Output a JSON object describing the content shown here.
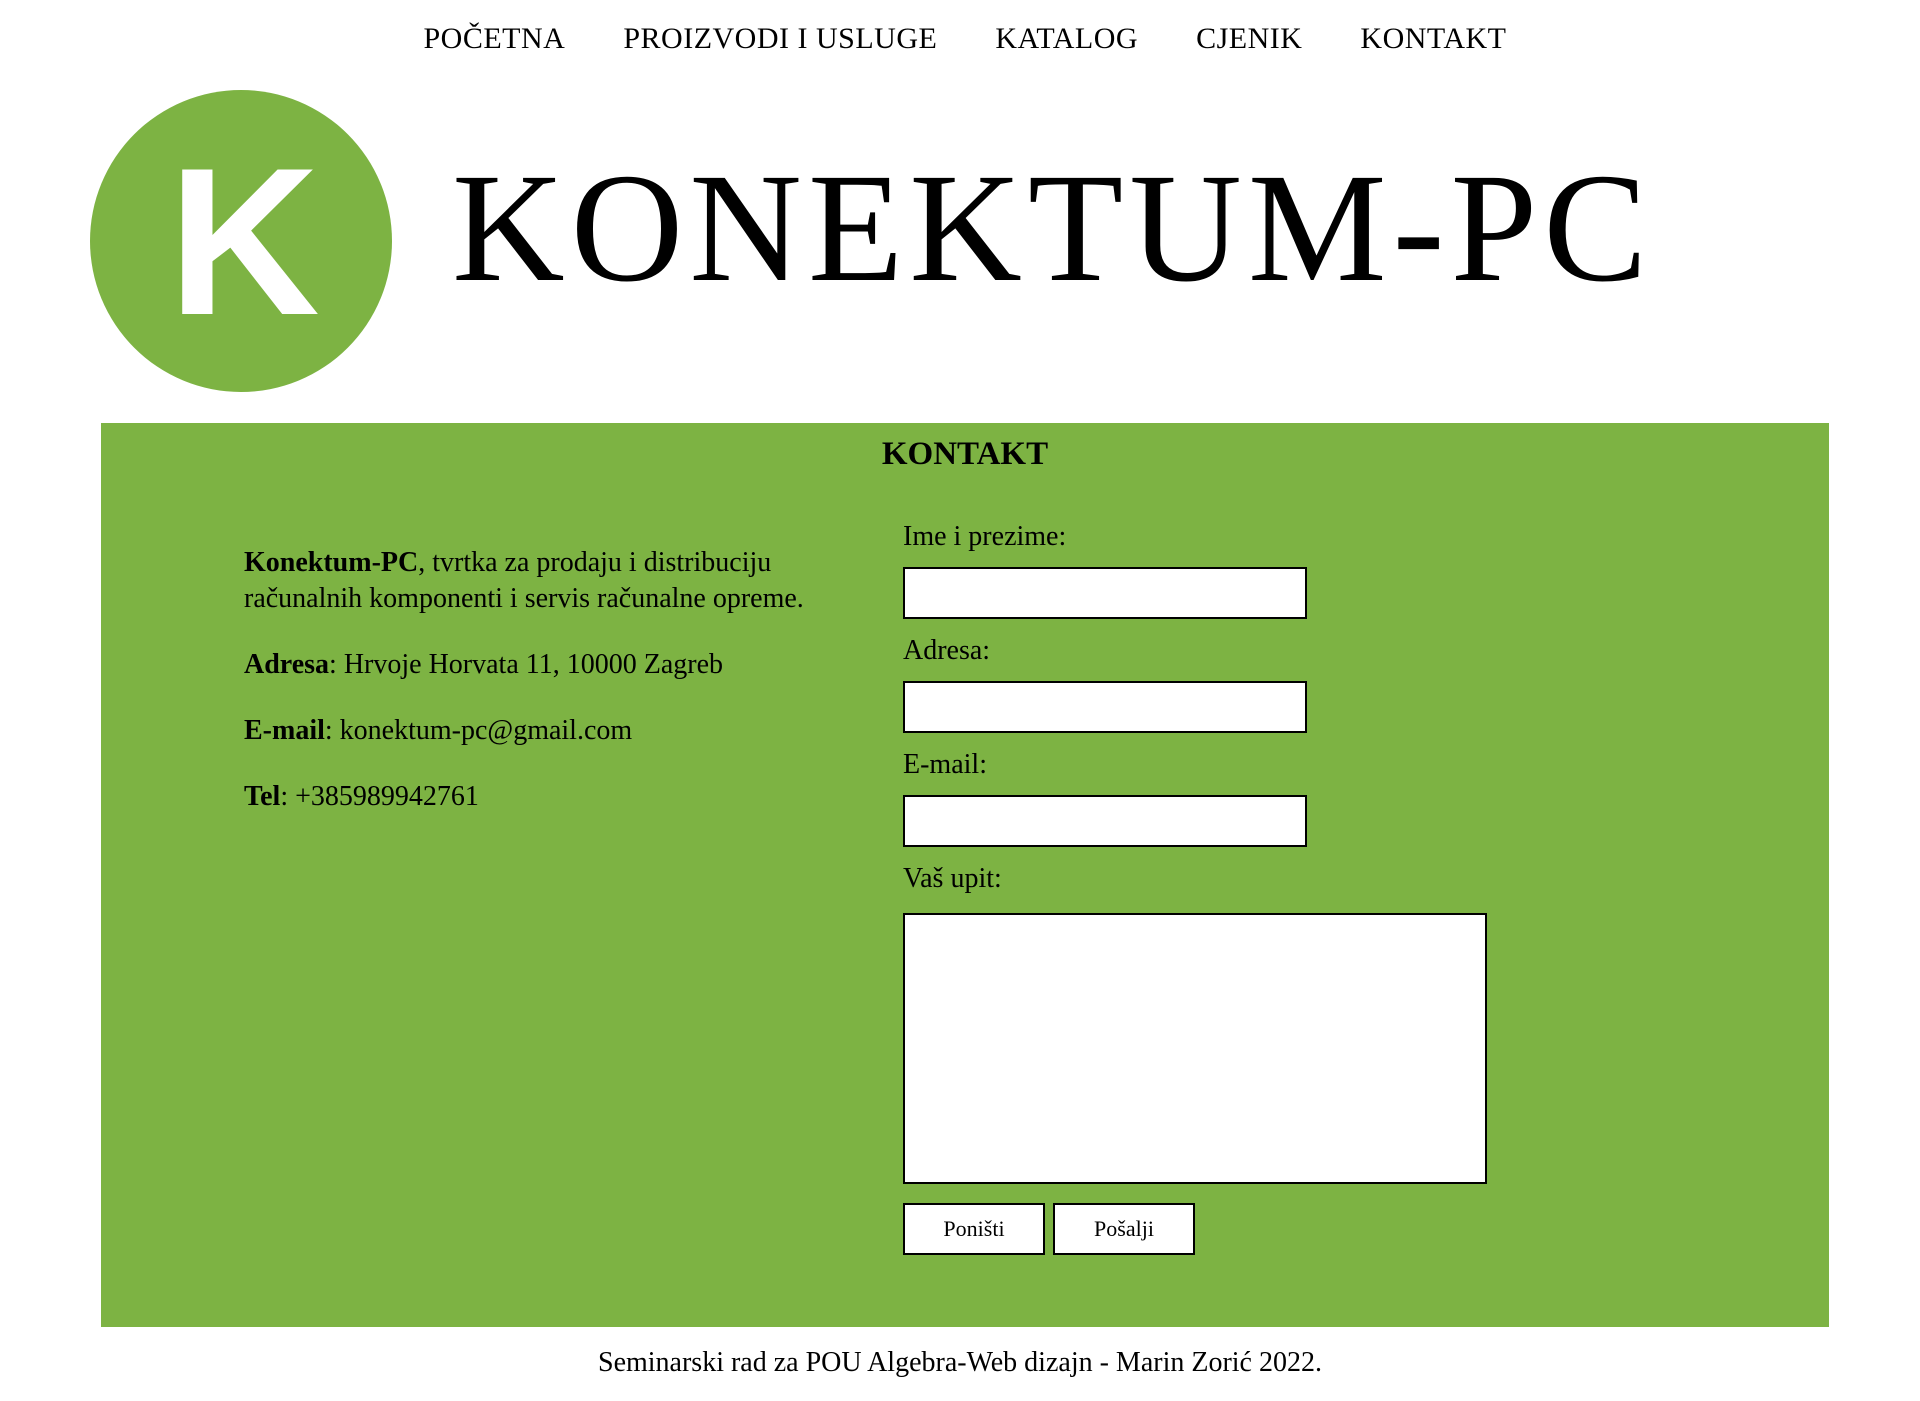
{
  "nav": {
    "items": [
      {
        "label": "POČETNA"
      },
      {
        "label": "PROIZVODI I USLUGE"
      },
      {
        "label": "KATALOG"
      },
      {
        "label": "CJENIK"
      },
      {
        "label": "KONTAKT"
      }
    ]
  },
  "brand": {
    "logo_letter": "K",
    "title": "KONEKTUM-PC",
    "color": "#7db343"
  },
  "contact": {
    "heading": "KONTAKT",
    "company_name": "Konektum-PC",
    "description": ", tvrtka za prodaju i distribuciju računalnih komponenti i servis računalne opreme.",
    "address_label": "Adresa",
    "address_value": ": Hrvoje Horvata 11, 10000 Zagreb",
    "email_label": "E-mail",
    "email_value": ": konektum-pc@gmail.com",
    "tel_label": "Tel",
    "tel_value": ": +385989942761"
  },
  "form": {
    "name_label": "Ime i prezime:",
    "name_value": "",
    "address_label": "Adresa:",
    "address_value": "",
    "email_label": "E-mail:",
    "email_value": "",
    "message_label": "Vaš upit:",
    "message_value": "",
    "reset_label": "Poništi",
    "submit_label": "Pošalji"
  },
  "footer": {
    "text": "Seminarski rad za POU Algebra-Web dizajn - Marin Zorić 2022."
  }
}
